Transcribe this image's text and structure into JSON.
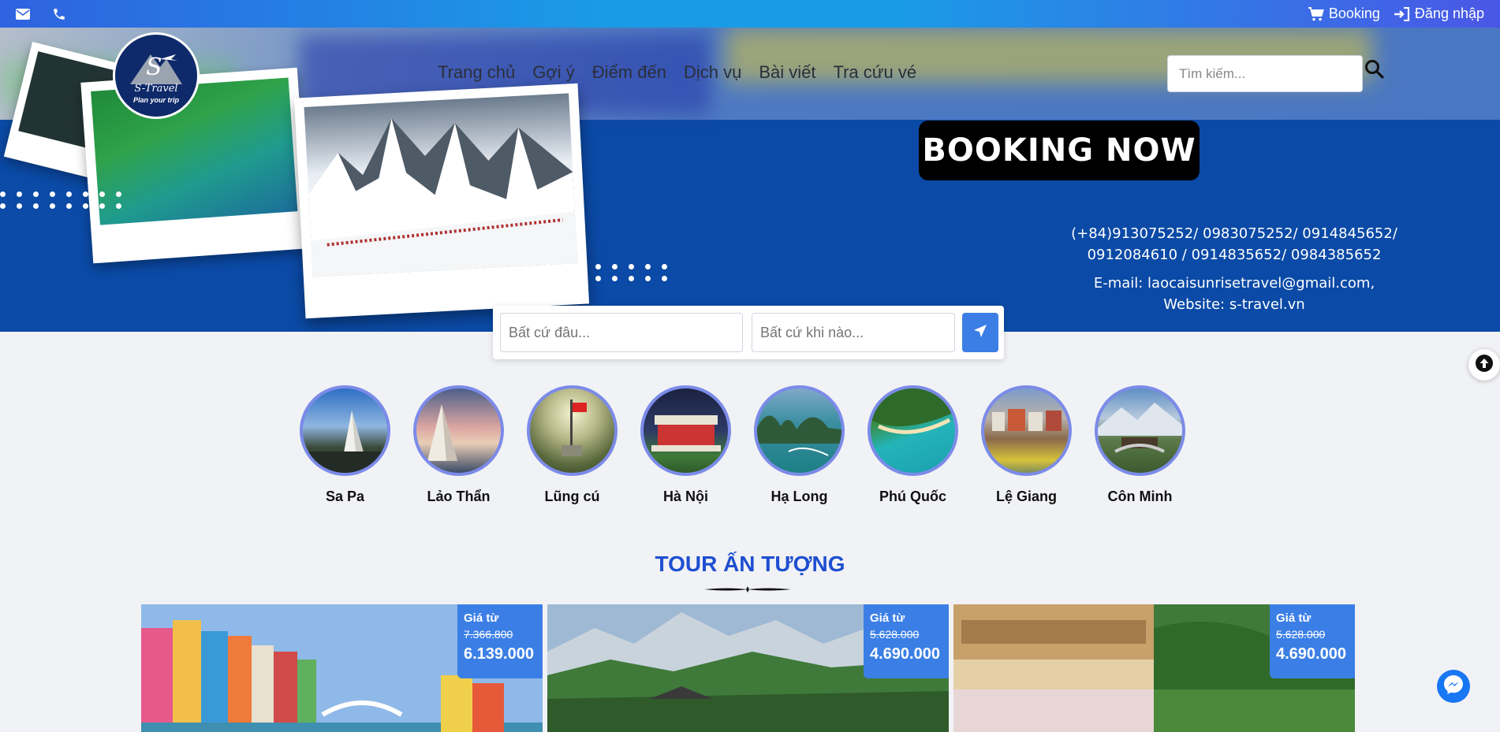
{
  "topbar": {
    "icons": [
      "envelope-icon",
      "phone-icon"
    ],
    "booking_label": "Booking",
    "login_label": "Đăng nhập"
  },
  "nav": {
    "logo_text": "S-Travel",
    "logo_tagline": "Plan your trip",
    "menu": [
      "Trang chủ",
      "Gợi ý",
      "Điểm đến",
      "Dịch vụ",
      "Bài viết",
      "Tra cứu vé"
    ],
    "search_placeholder": "Tìm kiếm..."
  },
  "hero": {
    "booking_banner": "BOOKING NOW",
    "phones": "(+84)913075252/ 0983075252/ 0914845652/ 0912084610 / 0914835652/ 0984385652",
    "email": "E-mail: laocaisunrisetravel@gmail.com,",
    "website": "Website: s-travel.vn"
  },
  "trip_search": {
    "where_placeholder": "Bất cứ đâu...",
    "when_placeholder": "Bất cứ khi nào..."
  },
  "destinations": [
    {
      "name": "Sa Pa"
    },
    {
      "name": "Lảo Thẩn"
    },
    {
      "name": "Lũng cú"
    },
    {
      "name": "Hà Nội"
    },
    {
      "name": "Hạ Long"
    },
    {
      "name": "Phú Quốc"
    },
    {
      "name": "Lệ Giang"
    },
    {
      "name": "Côn Minh"
    }
  ],
  "section_title": "TOUR ẤN TƯỢNG",
  "tours": [
    {
      "price_label": "Giá từ",
      "old_price": "7.366.800",
      "new_price": "6.139.000"
    },
    {
      "price_label": "Giá từ",
      "old_price": "5.628.000",
      "new_price": "4.690.000"
    },
    {
      "price_label": "Giá từ",
      "old_price": "5.628.000",
      "new_price": "4.690.000"
    }
  ],
  "colors": {
    "hero_blue": "#0b4aa6",
    "accent_blue": "#3b7fe6",
    "title_blue": "#1f4fd0"
  }
}
